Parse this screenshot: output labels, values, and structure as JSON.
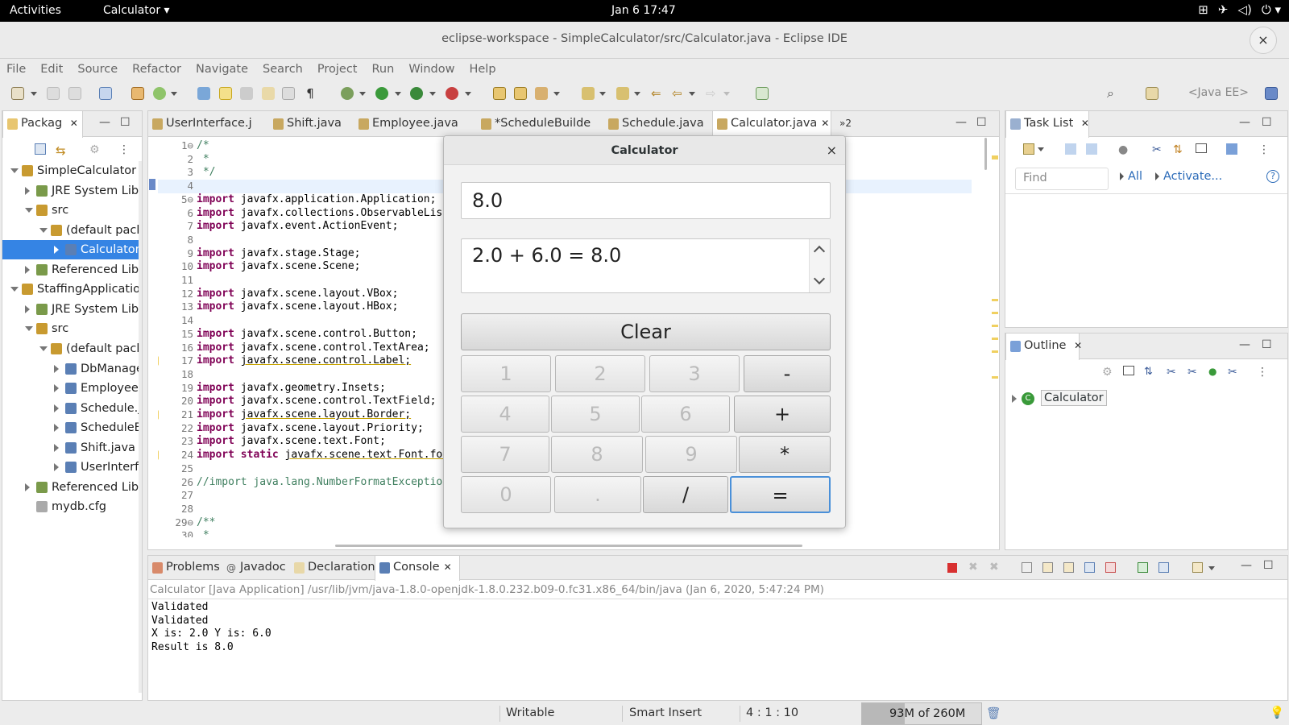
{
  "topbar": {
    "activities": "Activities",
    "app_menu": "Calculator",
    "clock": "Jan 6  17:47"
  },
  "window": {
    "title": "eclipse-workspace - SimpleCalculator/src/Calculator.java - Eclipse IDE",
    "close": "×"
  },
  "menu": [
    "File",
    "Edit",
    "Source",
    "Refactor",
    "Navigate",
    "Search",
    "Project",
    "Run",
    "Window",
    "Help"
  ],
  "toolbar": {
    "perspective": "<Java EE>"
  },
  "package_explorer": {
    "tab": "Packag",
    "items": [
      {
        "label": "SimpleCalculator",
        "icon": "project-icon"
      },
      {
        "label": "JRE System Libra",
        "icon": "library-icon"
      },
      {
        "label": "src",
        "icon": "source-folder-icon"
      },
      {
        "label": "(default packag",
        "icon": "package-icon"
      },
      {
        "label": "Calculator.j",
        "icon": "java-file-icon"
      },
      {
        "label": "Referenced Libra",
        "icon": "library-icon"
      },
      {
        "label": "StaffingApplication",
        "icon": "project-icon"
      },
      {
        "label": "JRE System Libra",
        "icon": "library-icon"
      },
      {
        "label": "src",
        "icon": "source-folder-icon"
      },
      {
        "label": "(default packag",
        "icon": "package-icon"
      },
      {
        "label": "DbManager",
        "icon": "java-file-icon"
      },
      {
        "label": "Employee.ja",
        "icon": "java-file-icon"
      },
      {
        "label": "Schedule.ja",
        "icon": "java-file-icon"
      },
      {
        "label": "ScheduleBu",
        "icon": "java-file-icon"
      },
      {
        "label": "Shift.java",
        "icon": "java-file-icon"
      },
      {
        "label": "UserInterfa",
        "icon": "java-file-icon"
      },
      {
        "label": "Referenced Libra",
        "icon": "library-icon"
      },
      {
        "label": "mydb.cfg",
        "icon": "file-icon"
      }
    ]
  },
  "editor": {
    "tabs": [
      "UserInterface.j",
      "Shift.java",
      "Employee.java",
      "*ScheduleBuilde",
      "Schedule.java",
      "Calculator.java"
    ],
    "overflow": "»2",
    "lines": [
      {
        "n": "1",
        "t": "/*"
      },
      {
        "n": "2",
        "t": " *"
      },
      {
        "n": "3",
        "t": " */"
      },
      {
        "n": "4",
        "t": ""
      },
      {
        "n": "5",
        "t": "import javafx.application.Application;"
      },
      {
        "n": "6",
        "t": "import javafx.collections.ObservableList"
      },
      {
        "n": "7",
        "t": "import javafx.event.ActionEvent;"
      },
      {
        "n": "8",
        "t": ""
      },
      {
        "n": "9",
        "t": "import javafx.stage.Stage;"
      },
      {
        "n": "10",
        "t": "import javafx.scene.Scene;"
      },
      {
        "n": "11",
        "t": ""
      },
      {
        "n": "12",
        "t": "import javafx.scene.layout.VBox;"
      },
      {
        "n": "13",
        "t": "import javafx.scene.layout.HBox;"
      },
      {
        "n": "14",
        "t": ""
      },
      {
        "n": "15",
        "t": "import javafx.scene.control.Button;"
      },
      {
        "n": "16",
        "t": "import javafx.scene.control.TextArea;"
      },
      {
        "n": "17",
        "t": "import javafx.scene.control.Label;"
      },
      {
        "n": "18",
        "t": ""
      },
      {
        "n": "19",
        "t": "import javafx.geometry.Insets;"
      },
      {
        "n": "20",
        "t": "import javafx.scene.control.TextField;"
      },
      {
        "n": "21",
        "t": "import javafx.scene.layout.Border;"
      },
      {
        "n": "22",
        "t": "import javafx.scene.layout.Priority;"
      },
      {
        "n": "23",
        "t": "import javafx.scene.text.Font;"
      },
      {
        "n": "24",
        "t": "import static javafx.scene.text.Font.for"
      },
      {
        "n": "25",
        "t": ""
      },
      {
        "n": "26",
        "t": "//import java.lang.NumberFormatException"
      },
      {
        "n": "27",
        "t": ""
      },
      {
        "n": "28",
        "t": ""
      },
      {
        "n": "29",
        "t": "/**"
      },
      {
        "n": "30",
        "t": " *"
      }
    ]
  },
  "calculator": {
    "title": "Calculator",
    "close": "×",
    "display": "8.0",
    "history": "2.0 + 6.0 = 8.0",
    "clear": "Clear",
    "buttons": [
      [
        "1",
        "2",
        "3",
        "-"
      ],
      [
        "4",
        "5",
        "6",
        "+"
      ],
      [
        "7",
        "8",
        "9",
        "*"
      ],
      [
        "0",
        ".",
        "/",
        "="
      ]
    ]
  },
  "task_list": {
    "tab": "Task List",
    "find_placeholder": "Find",
    "all": "All",
    "activate": "Activate..."
  },
  "outline": {
    "tab": "Outline",
    "item": "Calculator"
  },
  "console": {
    "tabs": [
      "Problems",
      "Javadoc",
      "Declaration",
      "Console"
    ],
    "header": "Calculator [Java Application] /usr/lib/jvm/java-1.8.0-openjdk-1.8.0.232.b09-0.fc31.x86_64/bin/java (Jan 6, 2020, 5:47:24 PM)",
    "lines": [
      "Validated",
      "Validated",
      "X is: 2.0 Y is: 6.0",
      "Result is 8.0"
    ]
  },
  "status": {
    "writable": "Writable",
    "insert_mode": "Smart Insert",
    "position": "4 : 1 : 10",
    "heap": "93M of 260M",
    "heap_fraction": 0.36
  },
  "colors": {
    "selection": "#3584e4",
    "keyword": "#7f0055",
    "comment": "#3f7f5f",
    "eq_focus": "#4a90d9"
  }
}
